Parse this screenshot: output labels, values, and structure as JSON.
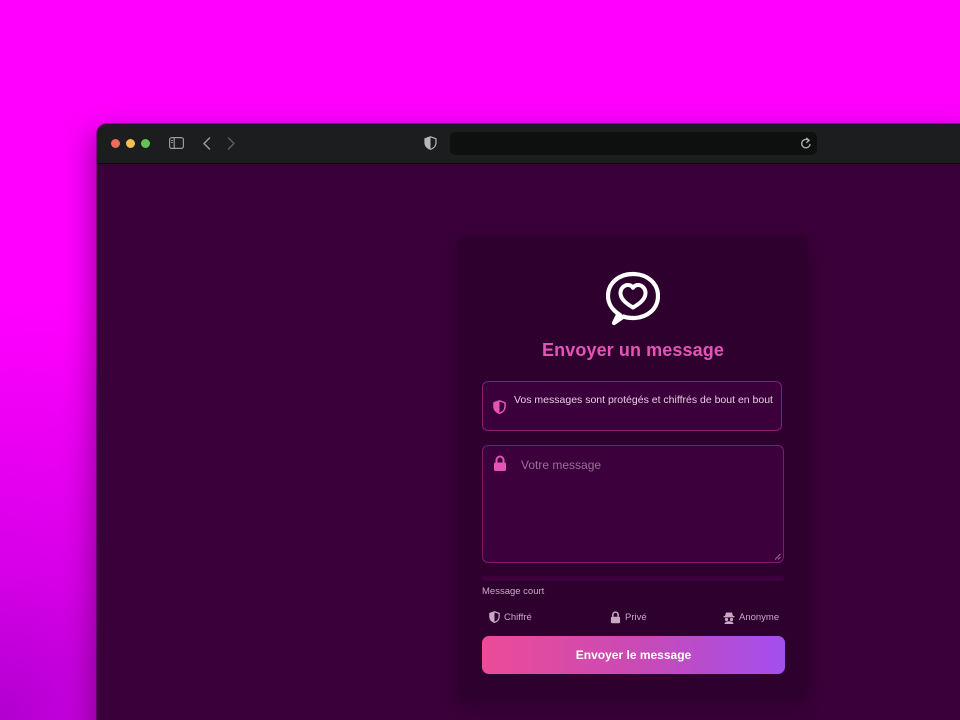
{
  "browser": {
    "icons": {
      "sidebar_toggle": "sidebar-toggle-icon",
      "back": "chevron-left-icon",
      "forward": "chevron-right-icon",
      "privacy": "half-shield-icon",
      "reload": "reload-icon"
    },
    "address": ""
  },
  "form": {
    "title": "Envoyer un message",
    "notice": "Vos messages sont protégés et chiffrés de bout en bout",
    "message_placeholder": "Votre message",
    "message_value": "",
    "length_label": "Message court",
    "length_fill": 0,
    "features": [
      {
        "icon": "shield-icon",
        "label": "Chiffré"
      },
      {
        "icon": "lock-icon",
        "label": "Privé"
      },
      {
        "icon": "incognito-icon",
        "label": "Anonyme"
      }
    ],
    "submit_label": "Envoyer le message"
  },
  "colors": {
    "page_background": "#ff00ff",
    "window_background": "#3a003a",
    "card_background": "#2d002e",
    "accent": "#e454b4",
    "button_gradient_start": "#ec4b97",
    "button_gradient_end": "#a24ff0"
  }
}
